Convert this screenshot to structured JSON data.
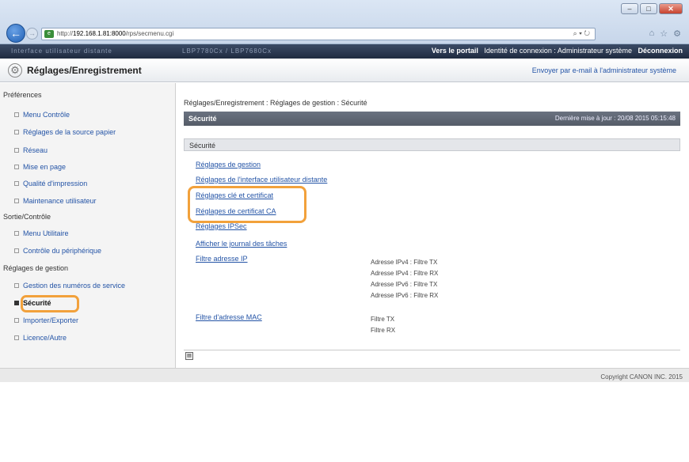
{
  "browser": {
    "url_prefix": "http://",
    "url_host": "192.168.1.81:8000",
    "url_path": "/rps/secmenu.cgi",
    "search_glyph": "⌕ ▾ ↻",
    "window_buttons": [
      "–",
      "□",
      "✕"
    ],
    "nav_icons": [
      "⌂",
      "☆",
      "⚙"
    ]
  },
  "topbar": {
    "device_name": "Interface utilisateur distante",
    "device_model": "LBP7780Cx / LBP7680Cx",
    "portal_link": "Vers le portail",
    "login_text": "Identité de connexion : Administrateur système",
    "logout_link": "Déconnexion"
  },
  "titlebar": {
    "title": "Réglages/Enregistrement",
    "mail_link": "Envoyer par e-mail à l'administrateur système"
  },
  "sidebar": {
    "sections": [
      {
        "heading": "Préférences",
        "items": [
          {
            "label": "Menu Contrôle"
          },
          {
            "label": "Réglages de la source papier"
          },
          {
            "label": "Réseau"
          },
          {
            "label": "Mise en page"
          },
          {
            "label": "Qualité d'impression"
          },
          {
            "label": "Maintenance utilisateur"
          }
        ]
      },
      {
        "heading": "Sortie/Contrôle",
        "items": [
          {
            "label": "Menu Utilitaire"
          },
          {
            "label": "Contrôle du périphérique"
          }
        ]
      },
      {
        "heading": "Réglages de gestion",
        "items": [
          {
            "label": "Gestion des numéros de service"
          },
          {
            "label": "Sécurité",
            "active": true
          },
          {
            "label": "Importer/Exporter"
          },
          {
            "label": "Licence/Autre"
          }
        ]
      }
    ]
  },
  "main": {
    "breadcrumb": "Réglages/Enregistrement : Réglages de gestion : Sécurité",
    "section_title": "Sécurité",
    "last_update": "Dernière mise à jour : 20/08 2015 05:15:48",
    "subsection_title": "Sécurité",
    "links": [
      "Réglages de gestion",
      "Réglages de l'interface utilisateur distante",
      "Réglages clé et certificat",
      "Réglages de certificat CA",
      "Réglages IPSec",
      "Afficher le journal des tâches",
      "Filtre adresse IP",
      "Filtre d'adresse MAC"
    ],
    "ip_filters": [
      "Adresse IPv4 : Filtre TX",
      "Adresse IPv4 : Filtre RX",
      "Adresse IPv6 : Filtre TX",
      "Adresse IPv6 : Filtre RX"
    ],
    "mac_filters": [
      "Filtre TX",
      "Filtre RX"
    ]
  },
  "footer": {
    "copyright": "Copyright CANON INC. 2015"
  },
  "colors": {
    "highlight": "#f2a13b",
    "link": "#2454a6",
    "header_dark": "#1f2b40"
  }
}
